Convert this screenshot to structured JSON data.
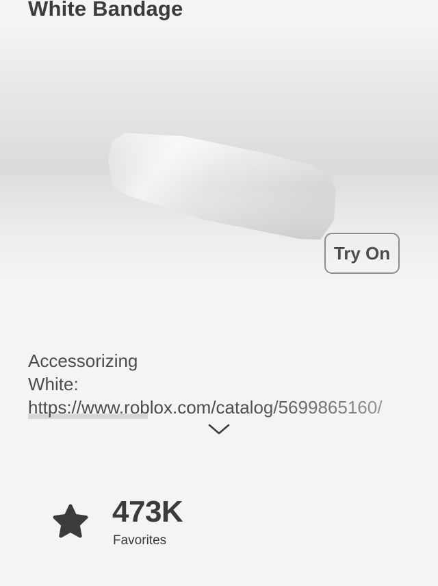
{
  "item": {
    "name": "White Bandage"
  },
  "preview": {
    "try_on_label": "Try On"
  },
  "description": {
    "line1": "Accessorizing",
    "line2": "White:",
    "link": "https://www.roblox.com/catalog/5699865160/"
  },
  "stats": {
    "favorites_count": "473K",
    "favorites_label": "Favorites"
  },
  "icons": {
    "expand": "chevron-down-icon",
    "favorite": "star-icon"
  }
}
